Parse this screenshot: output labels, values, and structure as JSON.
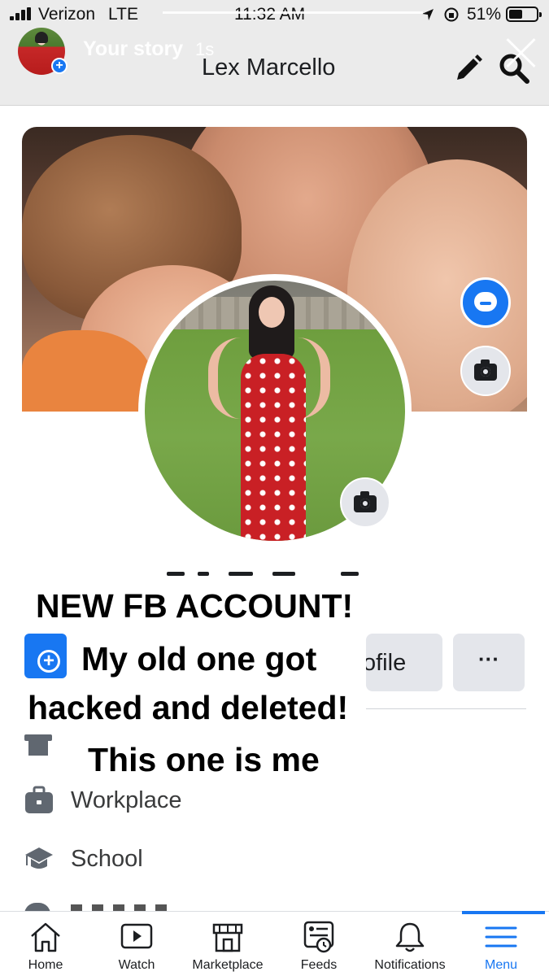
{
  "status_bar": {
    "carrier": "Verizon",
    "network": "LTE",
    "time": "11:32 AM",
    "battery": "51%",
    "battery_level": 0.51
  },
  "story": {
    "label": "Your story",
    "time": "1s"
  },
  "header": {
    "title": "Lex Marcello",
    "edit_icon": "pencil-icon",
    "search_icon": "search-icon",
    "close_icon": "close-icon"
  },
  "profile": {
    "edit_profile_label": "ofile",
    "more_label": "···"
  },
  "overlay_text": {
    "line1": "NEW FB ACCOUNT!",
    "line2": "My old one got",
    "line3": "hacked and deleted!",
    "line4": "This one is me"
  },
  "details": [
    {
      "icon": "briefcase-icon",
      "label": "Workplace"
    },
    {
      "icon": "graduation-cap-icon",
      "label": "School"
    }
  ],
  "tabs": [
    {
      "label": "Home",
      "icon": "home-icon",
      "active": false
    },
    {
      "label": "Watch",
      "icon": "watch-icon",
      "active": false
    },
    {
      "label": "Marketplace",
      "icon": "marketplace-icon",
      "active": false
    },
    {
      "label": "Feeds",
      "icon": "feeds-icon",
      "active": false
    },
    {
      "label": "Notifications",
      "icon": "bell-icon",
      "active": false
    },
    {
      "label": "Menu",
      "icon": "menu-icon",
      "active": true
    }
  ],
  "colors": {
    "accent": "#1877f2",
    "button_bg": "#e4e6eb",
    "text": "#1c1e21"
  }
}
